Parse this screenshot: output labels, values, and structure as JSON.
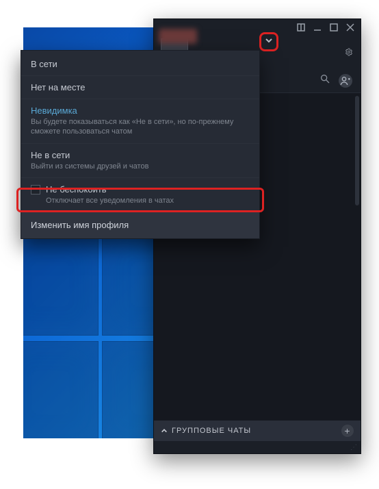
{
  "window": {
    "group_chats_label": "ГРУППОВЫЕ ЧАТЫ"
  },
  "dropdown": {
    "online": {
      "title": "В сети"
    },
    "away": {
      "title": "Нет на месте"
    },
    "invisible": {
      "title": "Невидимка",
      "sub": "Вы будете показываться как «Не в сети», но по-прежнему сможете пользоваться чатом"
    },
    "offline": {
      "title": "Не в сети",
      "sub": "Выйти из системы друзей и чатов"
    },
    "dnd": {
      "title": "Не беспокоить",
      "sub": "Отключает все уведомления в чатах"
    },
    "edit_name": "Изменить имя профиля"
  }
}
